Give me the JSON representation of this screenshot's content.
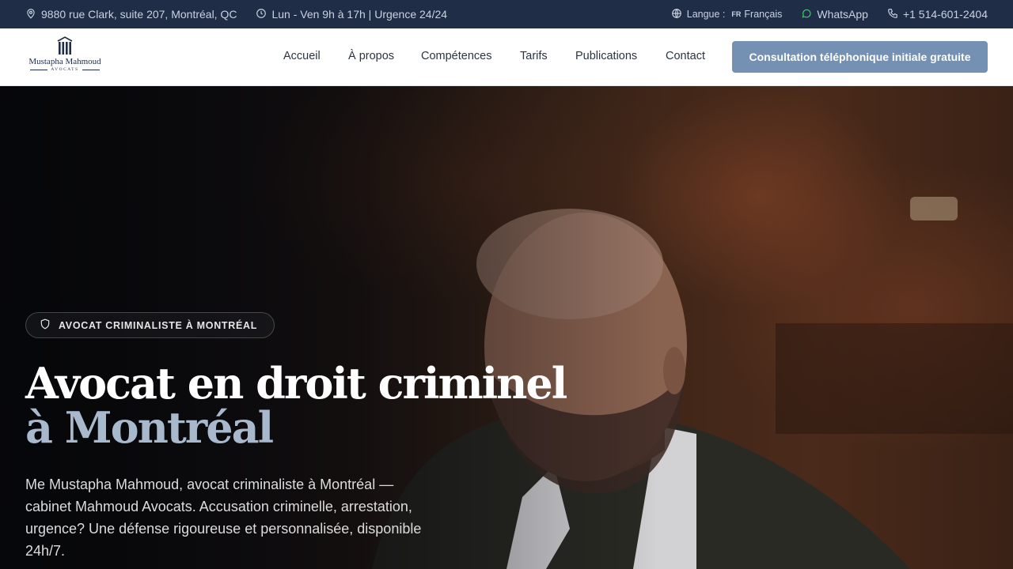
{
  "topbar": {
    "address": "9880 rue Clark, suite 207, Montréal, QC",
    "hours": "Lun - Ven 9h à 17h | Urgence 24/24",
    "language_label": "Langue :",
    "language_code": "FR",
    "language_name": "Français",
    "whatsapp": "WhatsApp",
    "phone": "+1 514-601-2404"
  },
  "logo": {
    "name": "Mustapha Mahmoud",
    "subtitle": "AVOCATS"
  },
  "nav": {
    "items": [
      {
        "label": "Accueil"
      },
      {
        "label": "À propos"
      },
      {
        "label": "Compétences"
      },
      {
        "label": "Tarifs"
      },
      {
        "label": "Publications"
      },
      {
        "label": "Contact"
      }
    ],
    "cta_label": "Consultation téléphonique initiale gratuite"
  },
  "hero": {
    "badge": "AVOCAT CRIMINALISTE À MONTRÉAL",
    "title_main": "Avocat en droit criminel ",
    "title_accent": "à Montréal",
    "description": "Me Mustapha Mahmoud, avocat criminaliste à Montréal — cabinet Mahmoud Avocats. Accusation criminelle, arrestation, urgence? Une défense rigoureuse et personnalisée, disponible 24h/7."
  },
  "colors": {
    "topbar_bg": "#1f2d47",
    "cta_bg": "#7490b3",
    "accent_text": "#a9b9cd",
    "whatsapp_green": "#3ecf6a"
  }
}
